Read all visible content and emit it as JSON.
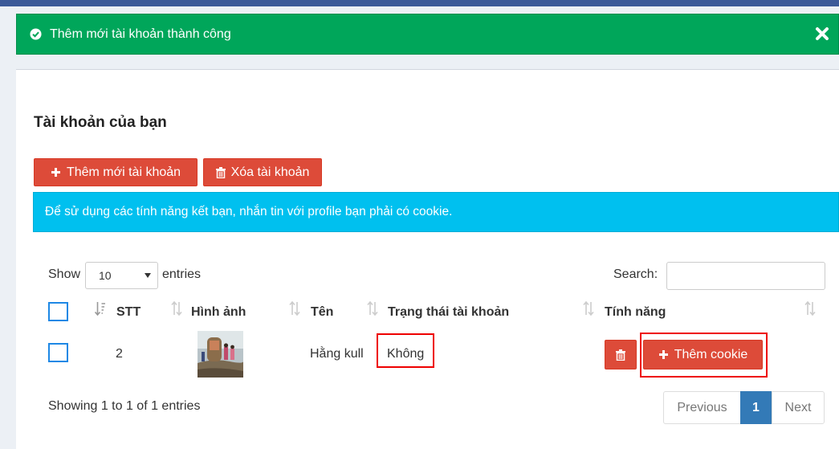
{
  "alert": {
    "message": "Thêm mới tài khoản thành công"
  },
  "card": {
    "title": "Tài khoản của bạn"
  },
  "toolbar": {
    "add_account_label": "Thêm mới tài khoản",
    "delete_account_label": "Xóa tài khoản"
  },
  "info": {
    "message": "Để sử dụng các tính năng kết bạn, nhắn tin với profile bạn phải có cookie."
  },
  "length": {
    "show_label": "Show",
    "value": "10",
    "entries_label": "entries"
  },
  "search": {
    "label": "Search:",
    "value": ""
  },
  "table": {
    "headers": [
      "STT",
      "Hình ảnh",
      "Tên",
      "Trạng thái tài khoản",
      "Tính năng"
    ],
    "rows": [
      {
        "stt": "2",
        "name": "Hằng kull",
        "status": "Không",
        "action_label": "Thêm cookie"
      }
    ]
  },
  "footer": {
    "info": "Showing 1 to 1 of 1 entries"
  },
  "pagination": {
    "previous": "Previous",
    "current": "1",
    "next": "Next"
  },
  "colors": {
    "success": "#00a65a",
    "info": "#00c0ef",
    "danger": "#dd4b39",
    "primary": "#337ab7",
    "highlight": "#ee0000"
  }
}
